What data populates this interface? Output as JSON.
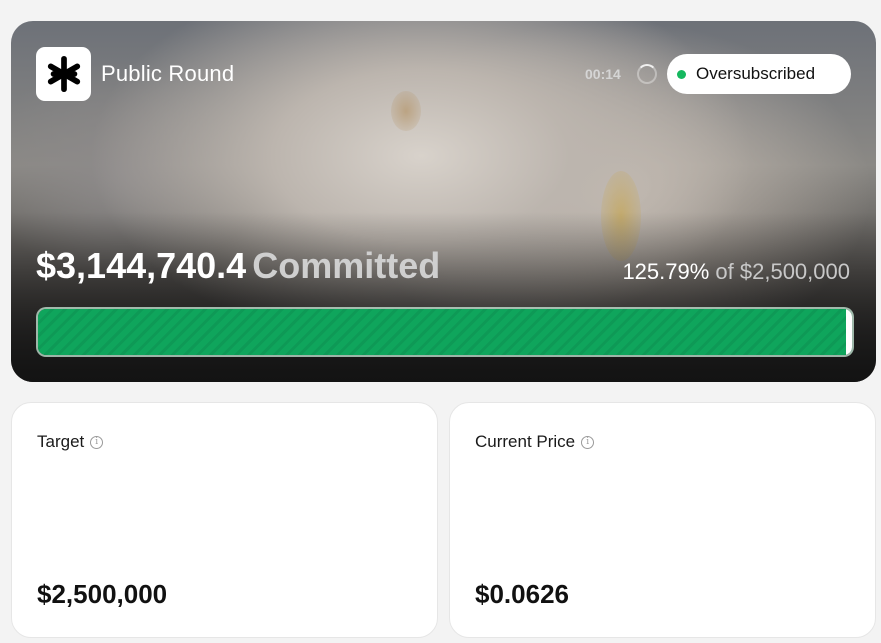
{
  "hero": {
    "title": "Public Round",
    "timer": "00:14",
    "status": "Oversubscribed",
    "committed_amount": "$3,144,740.4",
    "committed_word": "Committed",
    "percent": "125.79%",
    "of_label": "of $2,500,000",
    "progress_fraction": 1.0,
    "logo_icon": "asterisk-star-icon",
    "accent_color": "#0fa55c",
    "status_dot_color": "#16b85f"
  },
  "cards": {
    "target": {
      "label": "Target",
      "value": "$2,500,000"
    },
    "price": {
      "label": "Current Price",
      "value": "$0.0626"
    }
  }
}
